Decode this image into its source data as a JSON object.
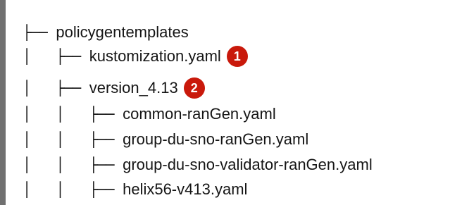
{
  "tree": [
    {
      "prefix": "├── ",
      "name": "policygentemplates",
      "callout": ""
    },
    {
      "prefix": "│   ├── ",
      "name": "kustomization.yaml",
      "callout": "1"
    },
    {
      "prefix": "│   ├── ",
      "name": "version_4.13",
      "callout": "2"
    },
    {
      "prefix": "│   │   ├── ",
      "name": "common-ranGen.yaml",
      "callout": ""
    },
    {
      "prefix": "│   │   ├── ",
      "name": "group-du-sno-ranGen.yaml",
      "callout": ""
    },
    {
      "prefix": "│   │   ├── ",
      "name": "group-du-sno-validator-ranGen.yaml",
      "callout": ""
    },
    {
      "prefix": "│   │   ├── ",
      "name": "helix56-v413.yaml",
      "callout": ""
    }
  ],
  "colors": {
    "callout": "#c9190b",
    "left_bar": "#707070",
    "text": "#151515"
  }
}
